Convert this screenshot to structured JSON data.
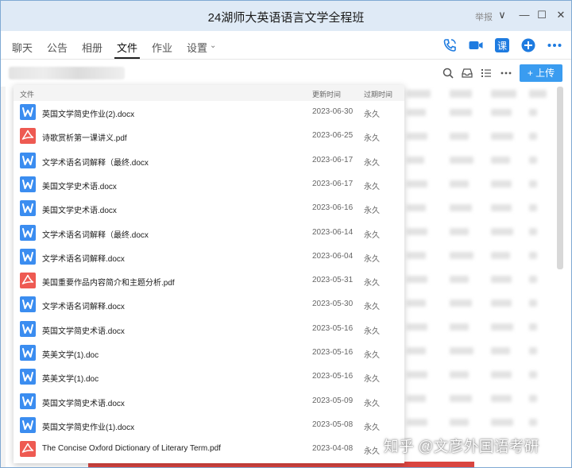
{
  "window": {
    "title": "24湖师大英语语言文学全程班",
    "report_label": "举报",
    "minimize_glyph": "—",
    "maximize_glyph": "☐",
    "close_glyph": "✕",
    "dropdown_glyph": "∨"
  },
  "tabs": [
    {
      "label": "聊天"
    },
    {
      "label": "公告"
    },
    {
      "label": "相册"
    },
    {
      "label": "文件"
    },
    {
      "label": "作业"
    },
    {
      "label": "设置"
    }
  ],
  "toolbar_icons": [
    "phone-icon",
    "video-icon",
    "course-icon",
    "add-icon",
    "more-icon"
  ],
  "course_icon_text": "课",
  "file_toolbar": {
    "upload_label": "上传",
    "upload_plus": "+"
  },
  "file_list": {
    "columns": {
      "file": "文件",
      "updated": "更新时间",
      "expiry": "过期时间"
    },
    "rows": [
      {
        "type": "doc",
        "name": "英国文学简史作业(2).docx",
        "date": "2023-06-30",
        "expiry": "永久"
      },
      {
        "type": "pdf",
        "name": "诗歌赏析第一课讲义.pdf",
        "date": "2023-06-25",
        "expiry": "永久"
      },
      {
        "type": "doc",
        "name": "文学术语名词解释（最终.docx",
        "date": "2023-06-17",
        "expiry": "永久"
      },
      {
        "type": "doc",
        "name": "美国文学史术语.docx",
        "date": "2023-06-17",
        "expiry": "永久"
      },
      {
        "type": "doc",
        "name": "美国文学史术语.docx",
        "date": "2023-06-16",
        "expiry": "永久"
      },
      {
        "type": "doc",
        "name": "文学术语名词解释（最终.docx",
        "date": "2023-06-14",
        "expiry": "永久"
      },
      {
        "type": "doc",
        "name": "文学术语名词解释.docx",
        "date": "2023-06-04",
        "expiry": "永久"
      },
      {
        "type": "pdf",
        "name": "美国重要作品内容简介和主题分析.pdf",
        "date": "2023-05-31",
        "expiry": "永久"
      },
      {
        "type": "doc",
        "name": "文学术语名词解释.docx",
        "date": "2023-05-30",
        "expiry": "永久"
      },
      {
        "type": "doc",
        "name": "英国文学简史术语.docx",
        "date": "2023-05-16",
        "expiry": "永久"
      },
      {
        "type": "doc",
        "name": "英美文学(1).doc",
        "date": "2023-05-16",
        "expiry": "永久"
      },
      {
        "type": "doc",
        "name": "英美文学(1).doc",
        "date": "2023-05-16",
        "expiry": "永久"
      },
      {
        "type": "doc",
        "name": "英国文学简史术语.docx",
        "date": "2023-05-09",
        "expiry": "永久"
      },
      {
        "type": "doc",
        "name": "英国文学简史作业(1).docx",
        "date": "2023-05-08",
        "expiry": "永久"
      },
      {
        "type": "pdf",
        "name": "The Concise Oxford Dictionary of Literary Term.pdf",
        "date": "2023-04-08",
        "expiry": "永久"
      }
    ]
  },
  "watermark": "知乎 @文彦外国语考研",
  "colors": {
    "accent": "#3a9cf0",
    "doc_icon": "#3b8df0",
    "pdf_icon": "#ee5a52",
    "titlebar": "#dfeaf6"
  }
}
